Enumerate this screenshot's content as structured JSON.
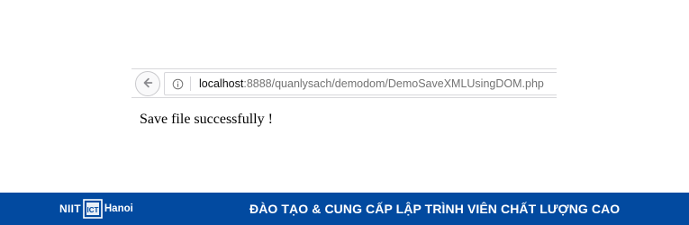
{
  "browser": {
    "url_host": "localhost",
    "url_path": ":8888/quanlysach/demodom/DemoSaveXMLUsingDOM.php",
    "back_icon": "back-arrow-icon",
    "info_icon": "info-icon"
  },
  "page": {
    "message": "Save file successfully !"
  },
  "footer": {
    "logo_brand": "NIIT",
    "logo_mark_text": "ICT",
    "logo_city": "Hanoi",
    "tagline": "ĐÀO TẠO & CUNG CẤP LẬP TRÌNH VIÊN CHẤT LƯỢNG CAO",
    "background_color": "#024aa0"
  }
}
